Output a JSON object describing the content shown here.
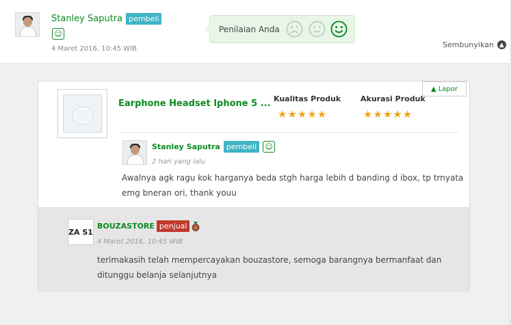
{
  "top": {
    "buyer_name": "Stanley Saputra",
    "buyer_badge": "pembeli",
    "date": "4 Maret 2016, 10:45 WIB",
    "rating_label": "Penilaian Anda",
    "hide_link": "Sembunyikan"
  },
  "card": {
    "report_label": "Lapor",
    "product_title": "Earphone Headset Iphone 5 ...",
    "quality_label": "Kualitas Produk",
    "quality_stars": 5,
    "accuracy_label": "Akurasi Produk",
    "accuracy_stars": 5,
    "review": {
      "name": "Stanley Saputra",
      "badge": "pembeli",
      "time": "2 hari yang lalu",
      "line1": "Awalnya agk ragu kok harganya beda stgh harga lebih d banding d ibox, tp trnyata",
      "line2": "emg bneran ori, thank youu"
    },
    "seller": {
      "name": "BOUZASTORE",
      "badge": "penjual",
      "logo_text": "ZA S1",
      "date": "4 Maret 2016, 10:45 WIB",
      "line1": "terimakasih telah mempercayakan bouzastore, semoga barangnya bermanfaat dan",
      "line2": "ditunggu belanja selanjutnya"
    }
  },
  "colors": {
    "green": "#0a8a20",
    "buyer_badge": "#3fb4c6",
    "seller_badge": "#c0392b",
    "star": "#f2a21a"
  }
}
